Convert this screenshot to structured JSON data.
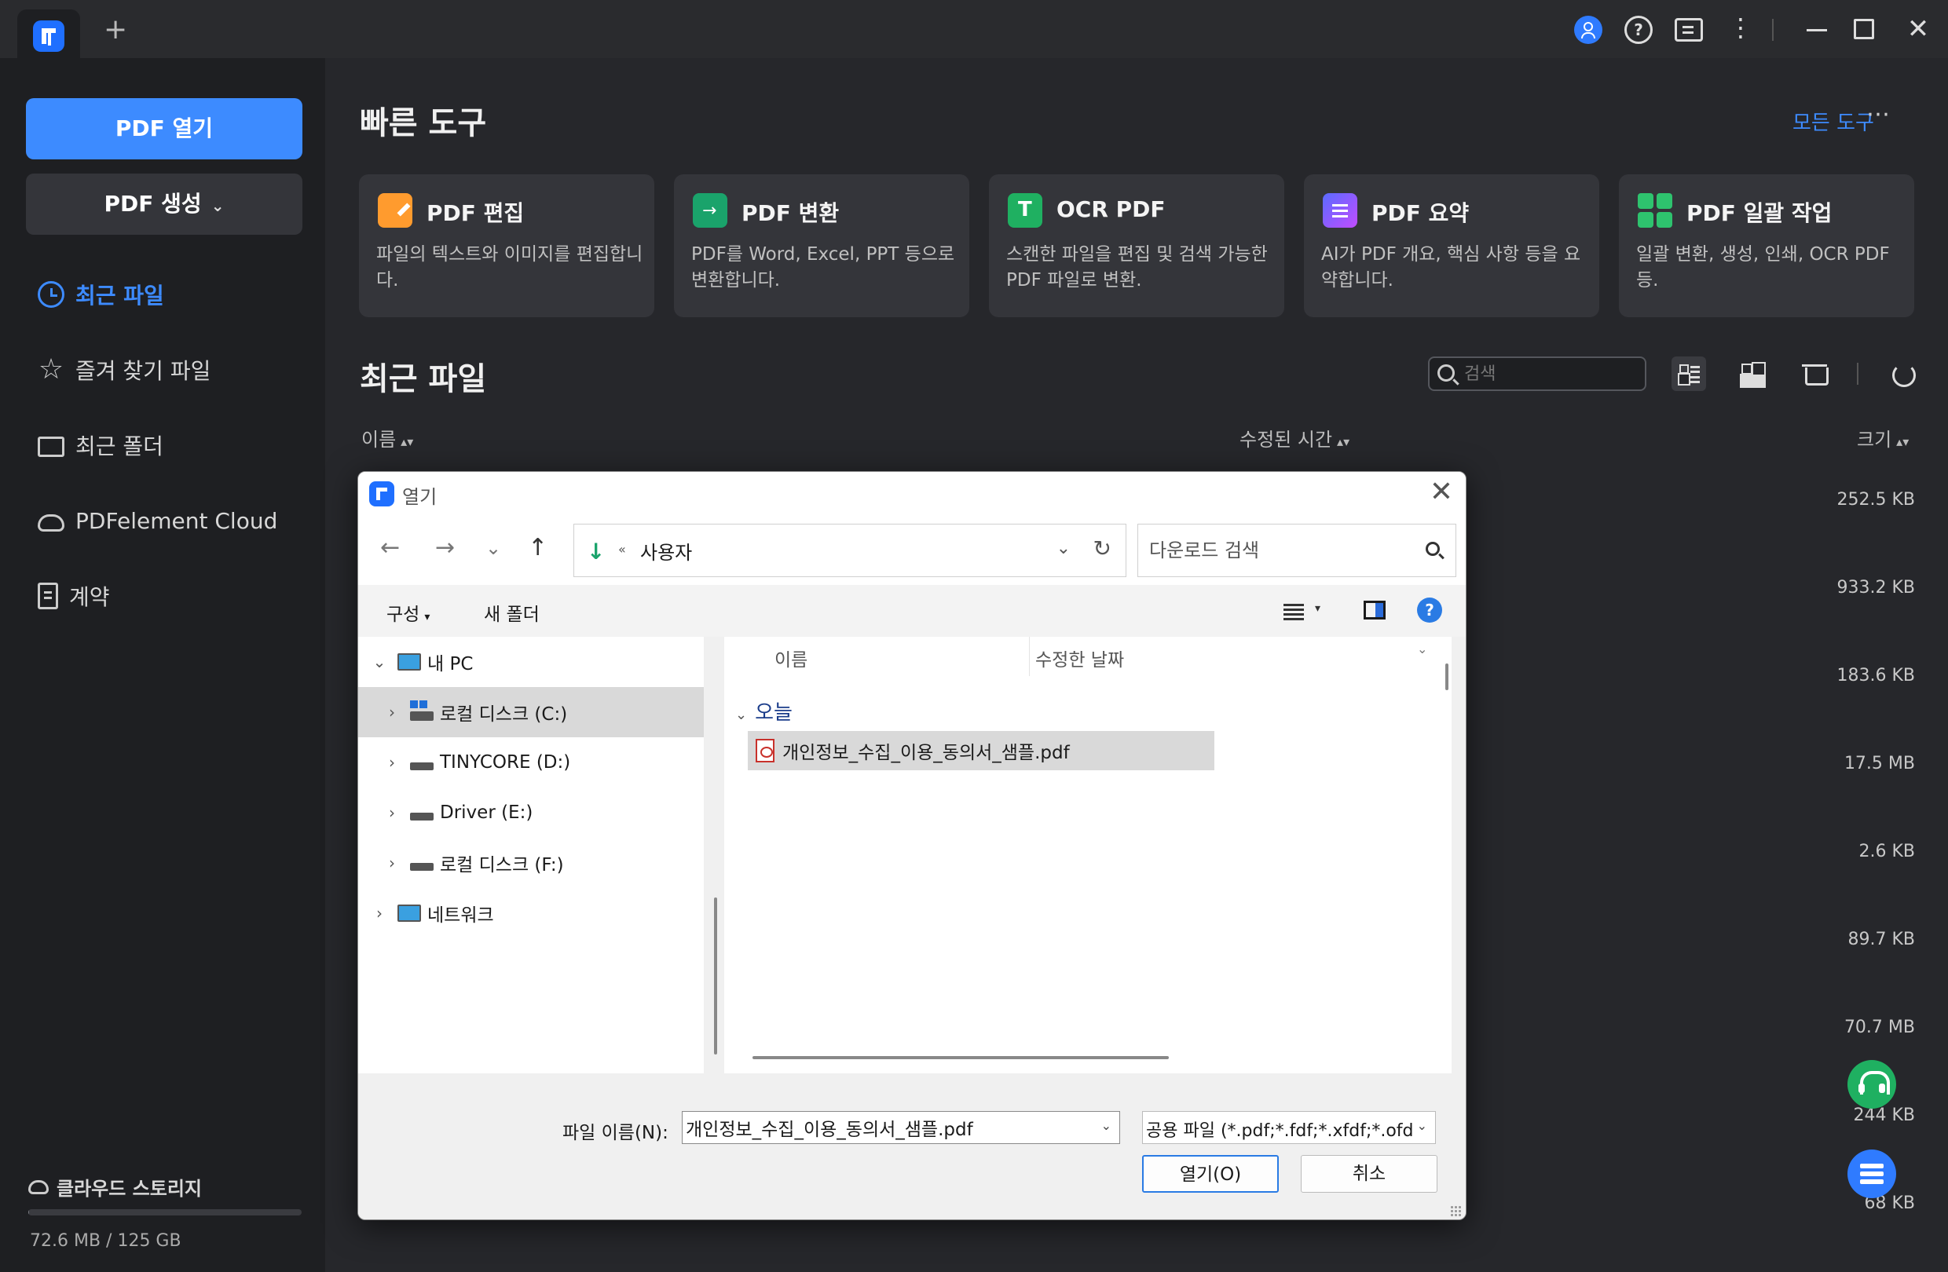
{
  "titlebar": {
    "new_tab": "+",
    "help": "?",
    "more": "⋮",
    "close": "✕"
  },
  "sidebar": {
    "open_pdf": "PDF 열기",
    "create_pdf": "PDF 생성",
    "create_chevron": "⌄",
    "items": [
      {
        "label": "최근 파일",
        "icon": "clock-icon",
        "active": true
      },
      {
        "label": "즐겨 찾기 파일",
        "icon": "star-icon"
      },
      {
        "label": "최근 폴더",
        "icon": "folder-icon"
      },
      {
        "label": "PDFelement Cloud",
        "icon": "cloud-icon"
      },
      {
        "label": "계약",
        "icon": "document-icon"
      }
    ],
    "storage": {
      "label": "클라우드 스토리지",
      "used_text": "72.6 MB / 125 GB",
      "used_fraction": 0.0006
    }
  },
  "quick_tools": {
    "title": "빠른 도구",
    "all_tools": "모든 도구",
    "more": "⋯",
    "cards": [
      {
        "name": "PDF 편집",
        "desc": "파일의 텍스트와 이미지를 편집합니다.",
        "icon": "pdf-edit-icon"
      },
      {
        "name": "PDF 변환",
        "desc": "PDF를 Word, Excel, PPT 등으로 변환합니다.",
        "icon": "pdf-convert-icon"
      },
      {
        "name": "OCR PDF",
        "desc": "스캔한 파일을 편집 및 검색 가능한 PDF 파일로 변환.",
        "icon": "ocr-icon"
      },
      {
        "name": "PDF 요약",
        "desc": "AI가 PDF 개요, 핵심 사항 등을 요약합니다.",
        "icon": "ai-summary-icon"
      },
      {
        "name": "PDF 일괄 작업",
        "desc": "일괄 변환, 생성, 인쇄, OCR PDF 등.",
        "icon": "batch-icon"
      }
    ]
  },
  "recent": {
    "title": "최근 파일",
    "search_placeholder": "검색",
    "columns": {
      "name": "이름",
      "modified": "수정된 시간",
      "size": "크기",
      "sort": "▴▾"
    },
    "sizes": [
      "252.5 KB",
      "933.2 KB",
      "183.6 KB",
      "17.5 MB",
      "2.6 KB",
      "89.7 KB",
      "70.7 MB",
      "244 KB",
      "68 KB"
    ]
  },
  "dialog": {
    "title": "열기",
    "close": "✕",
    "nav": {
      "back": "←",
      "forward": "→",
      "recent": "⌄",
      "up": "↑"
    },
    "address": {
      "chevrons": "«",
      "path": "사용자",
      "dropdown": "⌄",
      "refresh": "↻"
    },
    "search_placeholder": "다운로드 검색",
    "toolbar": {
      "organize": "구성",
      "dd": "▾",
      "new_folder": "새 폴더",
      "help": "?"
    },
    "tree": [
      {
        "label": "내 PC",
        "expander": "⌄",
        "icon": "computer-icon"
      },
      {
        "label": "로컬 디스크 (C:)",
        "expander": "›",
        "icon": "drive-c-icon",
        "selected": true
      },
      {
        "label": "TINYCORE (D:)",
        "expander": "›",
        "icon": "drive-icon"
      },
      {
        "label": "Driver (E:)",
        "expander": "›",
        "icon": "drive-icon"
      },
      {
        "label": "로컬 디스크 (F:)",
        "expander": "›",
        "icon": "drive-icon"
      },
      {
        "label": "네트워크",
        "expander": "›",
        "icon": "network-icon"
      }
    ],
    "files": {
      "col_name": "이름",
      "col_date": "수정한 날짜",
      "sort": "⌄",
      "group": "오늘",
      "group_chevron": "⌄",
      "items": [
        "개인정보_수집_이용_동의서_샘플.pdf"
      ]
    },
    "bottom": {
      "filename_label": "파일 이름(N):",
      "filename_value": "개인정보_수집_이용_동의서_샘플.pdf",
      "filetype": "공용 파일 (*.pdf;*.fdf;*.xfdf;*.ofd",
      "dd": "⌄",
      "open_btn": "열기(O)",
      "cancel_btn": "취소"
    }
  }
}
